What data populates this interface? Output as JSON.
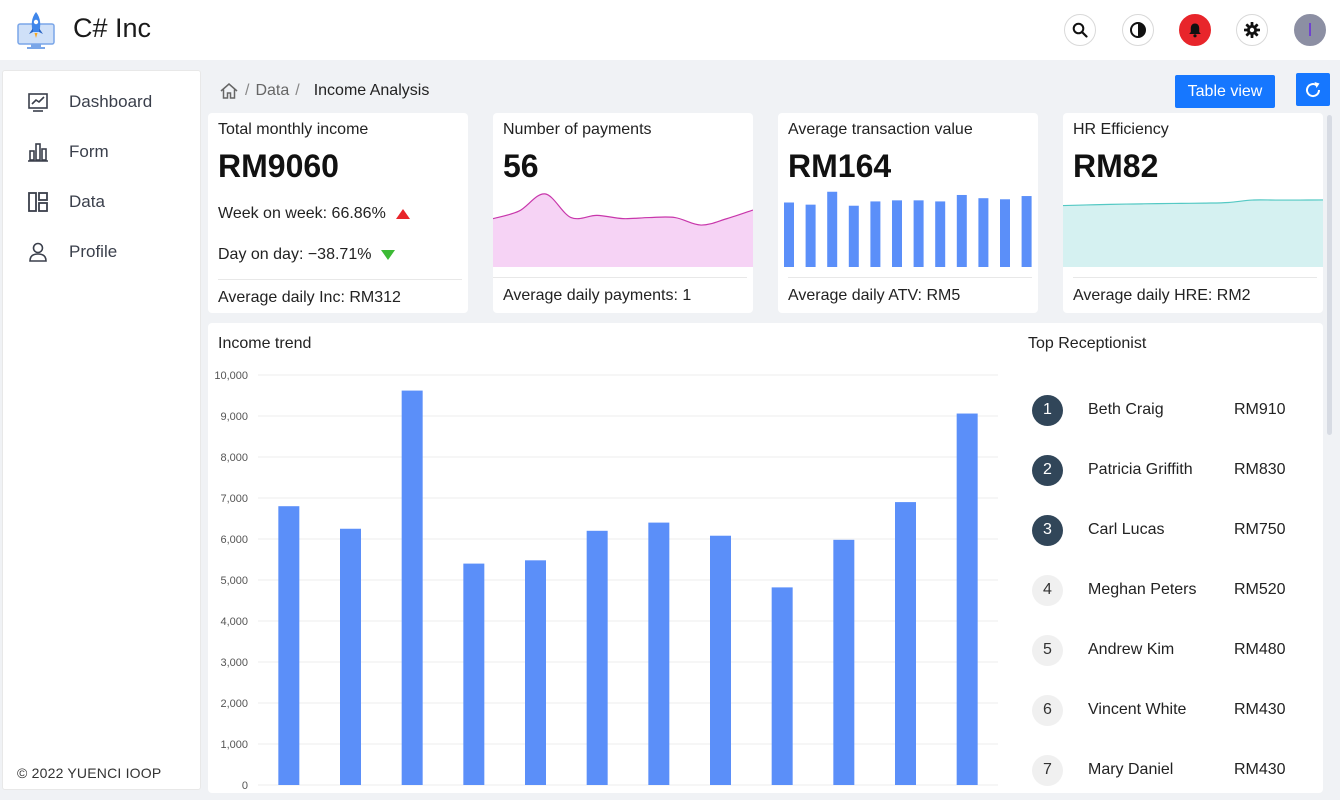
{
  "header": {
    "title": "C# Inc",
    "logo_icon": "rocket-monitor-icon",
    "icons": [
      "search-icon",
      "contrast-icon",
      "bell-icon",
      "gear-icon",
      "avatar"
    ],
    "avatar_initial": "I"
  },
  "sidebar": {
    "items": [
      {
        "label": "Dashboard",
        "icon": "line-chart-icon"
      },
      {
        "label": "Form",
        "icon": "bar-chart-icon"
      },
      {
        "label": "Data",
        "icon": "layout-icon"
      },
      {
        "label": "Profile",
        "icon": "user-icon"
      }
    ],
    "footer": "© 2022 YUENCI IOOP"
  },
  "breadcrumb": {
    "home_icon": "home-icon",
    "items": [
      "Data"
    ],
    "current": "Income Analysis"
  },
  "actions": {
    "table_view_label": "Table view",
    "refresh_icon": "refresh-icon"
  },
  "cards": {
    "income": {
      "title": "Total monthly income",
      "value": "RM9060",
      "week_on_week": "Week on week: 66.86%",
      "day_on_day": "Day on day: −38.71%",
      "footer": "Average daily Inc: RM312"
    },
    "payments": {
      "title": "Number of payments",
      "value": "56",
      "footer": "Average daily payments: 1",
      "spark": [
        4.5,
        5.2,
        6.8,
        4.6,
        4.8,
        4.5,
        4.6,
        4.6,
        3.9,
        4.5,
        5.3
      ]
    },
    "atv": {
      "title": "Average transaction value",
      "value": "RM164",
      "footer": "Average daily ATV: RM5",
      "bars": [
        60,
        58,
        70,
        57,
        61,
        62,
        62,
        61,
        67,
        64,
        63,
        66
      ]
    },
    "hr": {
      "title": "HR Efficiency",
      "value": "RM82",
      "footer": "Average daily HRE: RM2",
      "spark": [
        50,
        50.5,
        51,
        51.3,
        51.6,
        51.8,
        52,
        52.5,
        54.5,
        54.5,
        54.5,
        54.6
      ]
    }
  },
  "colors": {
    "primary": "#1677ff",
    "bar": "#5b8ff9",
    "payments_line": "#c837ab",
    "payments_fill": "#f6d3f5",
    "hr_line": "#55c9c4",
    "hr_fill": "#d5f1f1",
    "up": "#e8252b",
    "down": "#3cba35"
  },
  "income_trend": {
    "title": "Income trend"
  },
  "chart_data": {
    "type": "bar",
    "title": "Income trend",
    "categories": [
      "",
      "",
      "",
      "",
      "",
      "",
      "",
      "",
      "",
      "",
      "",
      ""
    ],
    "values": [
      6800,
      6250,
      9620,
      5400,
      5480,
      6200,
      6400,
      6080,
      4820,
      5980,
      6900,
      9060
    ],
    "ylim": [
      0,
      10000
    ],
    "yticks": [
      "0",
      "1,000",
      "2,000",
      "3,000",
      "4,000",
      "5,000",
      "6,000",
      "7,000",
      "8,000",
      "9,000",
      "10,000"
    ],
    "grid": true
  },
  "ranking": {
    "title": "Top Receptionist",
    "rows": [
      {
        "rank": "1",
        "name": "Beth Craig",
        "amount": "RM910"
      },
      {
        "rank": "2",
        "name": "Patricia Griffith",
        "amount": "RM830"
      },
      {
        "rank": "3",
        "name": "Carl Lucas",
        "amount": "RM750"
      },
      {
        "rank": "4",
        "name": "Meghan Peters",
        "amount": "RM520"
      },
      {
        "rank": "5",
        "name": "Andrew Kim",
        "amount": "RM480"
      },
      {
        "rank": "6",
        "name": "Vincent White",
        "amount": "RM430"
      },
      {
        "rank": "7",
        "name": "Mary Daniel",
        "amount": "RM430"
      }
    ]
  }
}
